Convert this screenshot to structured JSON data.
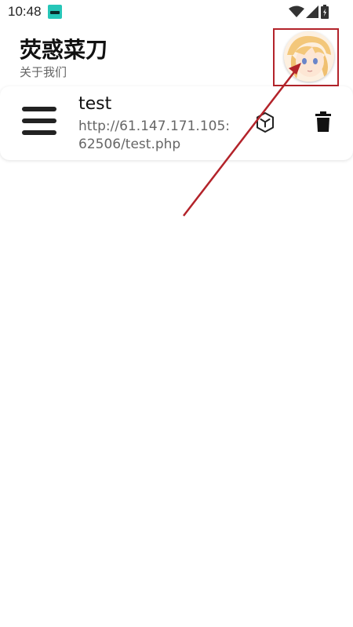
{
  "status_bar": {
    "time": "10:48"
  },
  "header": {
    "title": "荧惑菜刀",
    "subtitle": "关于我们"
  },
  "items": [
    {
      "title": "test",
      "url": "http://61.147.171.105:62506/test.php"
    }
  ],
  "colors": {
    "annotation": "#b3232a",
    "notif_icon": "#26c6b8"
  },
  "icons": [
    "menu-icon",
    "cube-icon",
    "trash-icon",
    "wifi-icon",
    "cellular-signal-icon",
    "battery-icon",
    "avatar"
  ]
}
